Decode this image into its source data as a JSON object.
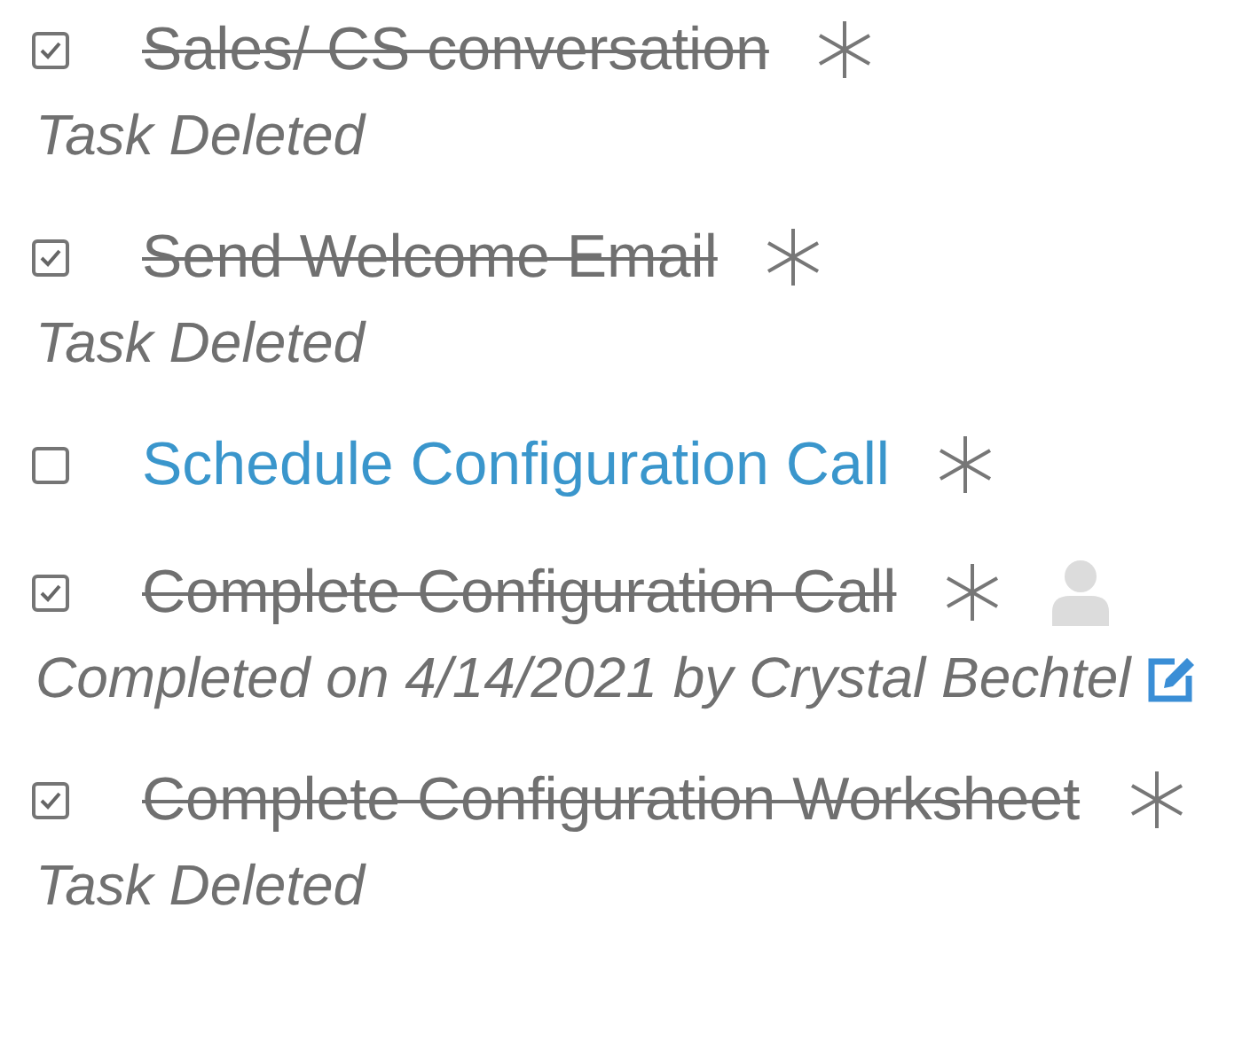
{
  "tasks": [
    {
      "title": "Sales/ CS conversation",
      "checked": true,
      "note": "Task Deleted",
      "assignee": false,
      "editable": false
    },
    {
      "title": "Send Welcome Email",
      "checked": true,
      "note": "Task Deleted",
      "assignee": false,
      "editable": false
    },
    {
      "title": "Schedule Configuration Call",
      "checked": false,
      "assignee": false,
      "editable": false
    },
    {
      "title": "Complete Configuration Call",
      "checked": true,
      "note": "Completed on 4/14/2021 by Crystal Bechtel",
      "assignee": true,
      "editable": true
    },
    {
      "title": "Complete Configuration Worksheet",
      "checked": true,
      "note": "Task Deleted",
      "assignee": false,
      "editable": false
    }
  ]
}
